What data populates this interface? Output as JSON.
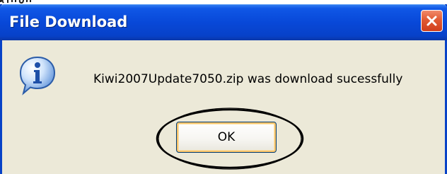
{
  "dialog": {
    "title": "File Download",
    "message": "Kiwi2007Update7050.zip was download sucessfully",
    "ok_label": "OK",
    "icon": "info-icon",
    "close_icon": "close-icon"
  },
  "colors": {
    "titlebar": "#0848d8",
    "body": "#ece9d8",
    "close_button": "#e15a33",
    "button_focus": "#f7c36a",
    "annotation": "#000000"
  }
}
